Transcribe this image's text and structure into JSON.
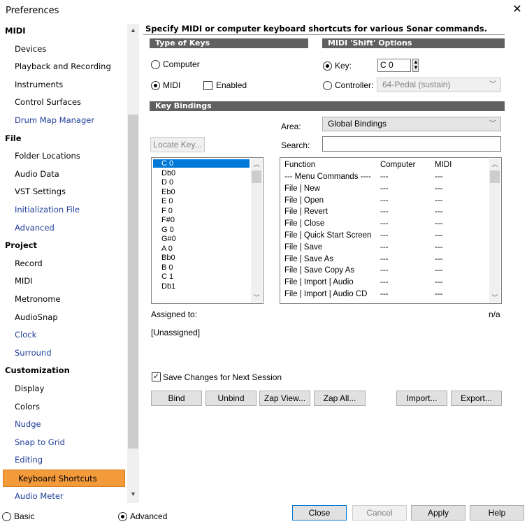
{
  "window": {
    "title": "Preferences",
    "close": "✕"
  },
  "sidebar": {
    "items": [
      {
        "label": "MIDI",
        "kind": "head"
      },
      {
        "label": "Devices",
        "kind": "item"
      },
      {
        "label": "Playback and Recording",
        "kind": "item"
      },
      {
        "label": "Instruments",
        "kind": "item"
      },
      {
        "label": "Control Surfaces",
        "kind": "item"
      },
      {
        "label": "Drum Map Manager",
        "kind": "link"
      },
      {
        "label": "File",
        "kind": "head"
      },
      {
        "label": "Folder Locations",
        "kind": "item"
      },
      {
        "label": "Audio Data",
        "kind": "item"
      },
      {
        "label": "VST Settings",
        "kind": "item"
      },
      {
        "label": "Initialization File",
        "kind": "link"
      },
      {
        "label": "Advanced",
        "kind": "link"
      },
      {
        "label": "Project",
        "kind": "head"
      },
      {
        "label": "Record",
        "kind": "item"
      },
      {
        "label": "MIDI",
        "kind": "item"
      },
      {
        "label": "Metronome",
        "kind": "item"
      },
      {
        "label": "AudioSnap",
        "kind": "item"
      },
      {
        "label": "Clock",
        "kind": "link"
      },
      {
        "label": "Surround",
        "kind": "link"
      },
      {
        "label": "Customization",
        "kind": "head"
      },
      {
        "label": "Display",
        "kind": "item"
      },
      {
        "label": "Colors",
        "kind": "item"
      },
      {
        "label": "Nudge",
        "kind": "link"
      },
      {
        "label": "Snap to Grid",
        "kind": "link"
      },
      {
        "label": "Editing",
        "kind": "link"
      },
      {
        "label": "Keyboard Shortcuts",
        "kind": "selected"
      },
      {
        "label": "Audio Meter",
        "kind": "link"
      }
    ]
  },
  "main": {
    "heading": "Specify MIDI or computer keyboard shortcuts for various Sonar commands.",
    "type_of_keys": {
      "title": "Type of Keys",
      "computer": "Computer",
      "midi": "MIDI",
      "enabled": "Enabled"
    },
    "shift_options": {
      "title": "MIDI 'Shift' Options",
      "key_label": "Key:",
      "key_value": "C 0",
      "controller_label": "Controller:",
      "controller_value": "64-Pedal (sustain)"
    },
    "key_bindings": {
      "title": "Key Bindings",
      "area_label": "Area:",
      "area_value": "Global Bindings",
      "search_label": "Search:",
      "locate_key": "Locate Key...",
      "keys": [
        "C 0",
        "Db0",
        "D 0",
        "Eb0",
        "E 0",
        "F 0",
        "F#0",
        "G 0",
        "G#0",
        "A 0",
        "Bb0",
        "B 0",
        "C 1",
        "Db1"
      ],
      "columns": [
        "Function",
        "Computer",
        "MIDI"
      ],
      "rows": [
        [
          "--- Menu Commands ----",
          "---",
          "---"
        ],
        [
          "File | New",
          "---",
          "---"
        ],
        [
          "File | Open",
          "---",
          "---"
        ],
        [
          "File | Revert",
          "---",
          "---"
        ],
        [
          "File | Close",
          "---",
          "---"
        ],
        [
          "File | Quick Start Screen",
          "---",
          "---"
        ],
        [
          "File | Save",
          "---",
          "---"
        ],
        [
          "File | Save As",
          "---",
          "---"
        ],
        [
          "File | Save Copy As",
          "---",
          "---"
        ],
        [
          "File | Import | Audio",
          "---",
          "---"
        ],
        [
          "File | Import | Audio CD",
          "---",
          "---"
        ]
      ],
      "assigned_to": "Assigned to:",
      "assigned_value": "n/a",
      "unassigned": "[Unassigned]",
      "save_changes": "Save Changes for Next Session",
      "buttons": {
        "bind": "Bind",
        "unbind": "Unbind",
        "zap_view": "Zap View...",
        "zap_all": "Zap All...",
        "import": "Import...",
        "export": "Export..."
      }
    }
  },
  "footer": {
    "basic": "Basic",
    "advanced": "Advanced",
    "close": "Close",
    "cancel": "Cancel",
    "apply": "Apply",
    "help": "Help"
  }
}
